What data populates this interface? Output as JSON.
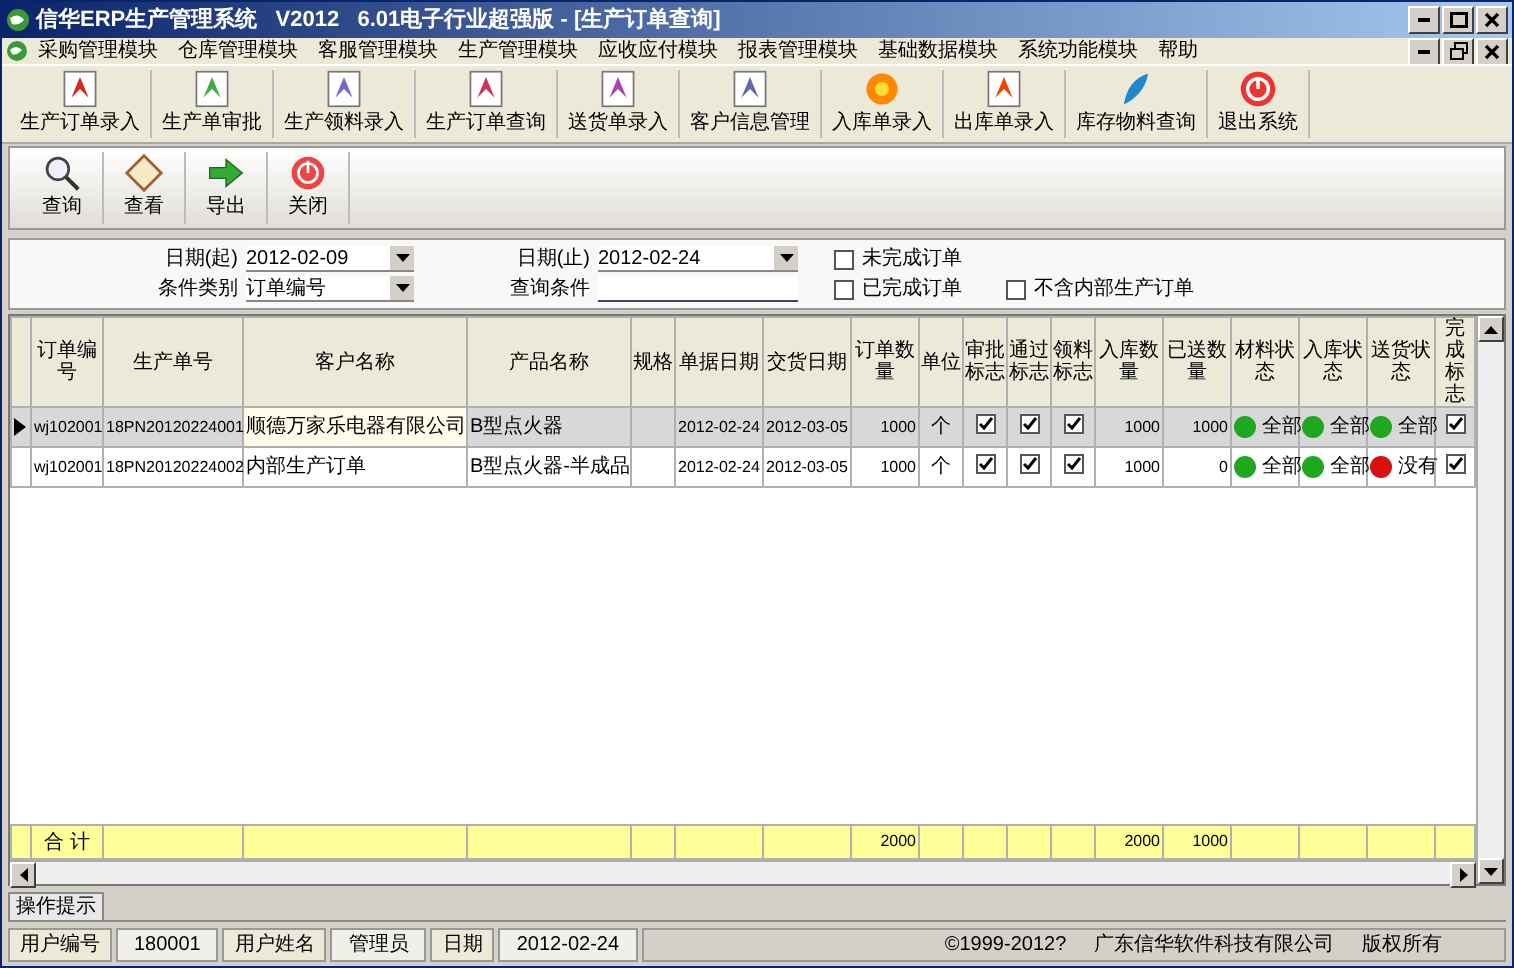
{
  "window": {
    "title": "信华ERP生产管理系统   V2012   6.01电子行业超强版 - [生产订单查询]"
  },
  "menu": [
    "采购管理模块",
    "仓库管理模块",
    "客服管理模块",
    "生产管理模块",
    "应收应付模块",
    "报表管理模块",
    "基础数据模块",
    "系统功能模块",
    "帮助"
  ],
  "module_toolbar": [
    "生产订单录入",
    "生产单审批",
    "生产领料录入",
    "生产订单查询",
    "送货单录入",
    "客户信息管理",
    "入库单录入",
    "出库单录入",
    "库存物料查询",
    "退出系统"
  ],
  "action_toolbar": [
    "查询",
    "查看",
    "导出",
    "关闭"
  ],
  "filters": {
    "date_from": {
      "label": "日期(起)",
      "value": "2012-02-09"
    },
    "date_to": {
      "label": "日期(止)",
      "value": "2012-02-24"
    },
    "condition_type": {
      "label": "条件类别",
      "value": "订单编号"
    },
    "query_condition": {
      "label": "查询条件"
    },
    "options": [
      {
        "label": "未完成订单",
        "checked": false
      },
      {
        "label": "已完成订单",
        "checked": false
      },
      {
        "label": "不含内部生产订单",
        "checked": false
      }
    ]
  },
  "table": {
    "columns": [
      "订单编号",
      "生产单号",
      "客户名称",
      "产品名称",
      "规格",
      "单据日期",
      "交货日期",
      "订单数量",
      "单位",
      "审批标志",
      "通过标志",
      "领料标志",
      "入库数量",
      "已送数量",
      "材料状态",
      "入库状态",
      "送货状态",
      "完成标志"
    ],
    "rows": [
      {
        "selected": true,
        "order_no": "wj102001",
        "production_no": "18PN20120224001",
        "customer": "顺德万家乐电器有限公司",
        "product": "B型点火器",
        "doc_date": "2012-02-24",
        "delivery_date": "2012-03-05",
        "order_qty": "1000",
        "unit": "个",
        "approval_flag": true,
        "pass_flag": true,
        "material_flag": true,
        "stock_in_qty": "1000",
        "shipped_qty": "1000",
        "material_status": {
          "label": "全部",
          "color": "#1fa81f"
        },
        "stock_in_status": {
          "label": "全部",
          "color": "#1fa81f"
        },
        "delivery_status": {
          "label": "全部",
          "color": "#1fa81f"
        },
        "done_flag": true
      },
      {
        "selected": false,
        "order_no": "wj102001",
        "production_no": "18PN20120224002",
        "customer": "内部生产订单",
        "product": "B型点火器-半成品",
        "doc_date": "2012-02-24",
        "delivery_date": "2012-03-05",
        "order_qty": "1000",
        "unit": "个",
        "approval_flag": true,
        "pass_flag": true,
        "material_flag": true,
        "stock_in_qty": "1000",
        "shipped_qty": "0",
        "material_status": {
          "label": "全部",
          "color": "#1fa81f"
        },
        "stock_in_status": {
          "label": "全部",
          "color": "#1fa81f"
        },
        "delivery_status": {
          "label": "没有",
          "color": "#d81010"
        },
        "done_flag": true
      }
    ],
    "total": {
      "label": "合 计",
      "order_qty": "2000",
      "stock_in_qty": "2000",
      "shipped_qty": "1000"
    }
  },
  "hint_tab": "操作提示",
  "status_bar": {
    "fields": [
      {
        "label": "用户编号",
        "value": "180001"
      },
      {
        "label": "用户姓名",
        "value": "管理员"
      },
      {
        "label": "日期",
        "value": "2012-02-24"
      }
    ],
    "copyright": "©1999-2012?",
    "company": "广东信华软件科技有限公司",
    "rights": "版权所有"
  }
}
